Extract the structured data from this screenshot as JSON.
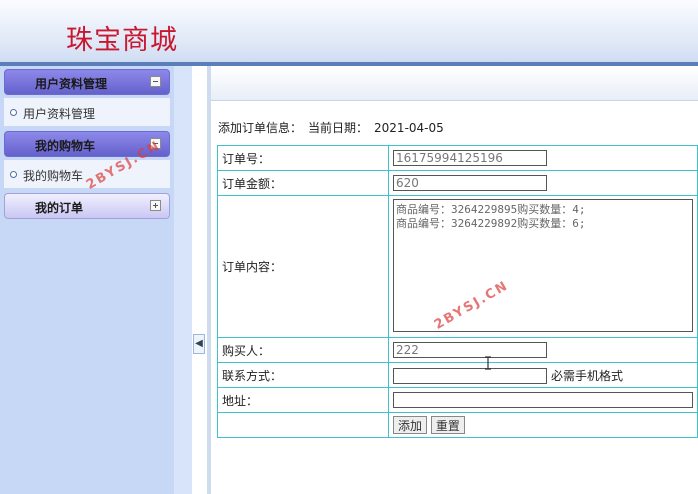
{
  "header": {
    "brand": "珠宝商城"
  },
  "sidebar": {
    "groups": [
      {
        "title": "用户资料管理",
        "items": [
          "用户资料管理"
        ],
        "expanded": true
      },
      {
        "title": "我的购物车",
        "items": [
          "我的购物车"
        ],
        "expanded": true
      },
      {
        "title": "我的订单",
        "items": [],
        "expanded": false
      }
    ]
  },
  "main": {
    "info_label": "添加订单信息：",
    "date_label": "当前日期：",
    "date_value": "2021-04-05",
    "fields": {
      "order_no_label": "订单号：",
      "order_no_value": "16175994125196",
      "amount_label": "订单金额：",
      "amount_value": "620",
      "content_label": "订单内容：",
      "content_value": "商品编号：3264229895购买数量：4;\n商品编号：3264229892购买数量：6;",
      "buyer_label": "购买人：",
      "buyer_value": "222",
      "contact_label": "联系方式：",
      "contact_value": "",
      "contact_hint": "必需手机格式",
      "address_label": "地址：",
      "address_value": ""
    },
    "buttons": {
      "add": "添加",
      "reset": "重置"
    }
  },
  "watermarks": [
    "2BYSJ.CN",
    "2BYSJ.CN",
    "2BYSJ.CN"
  ],
  "colors": {
    "brand": "#c8182f",
    "table_border": "#3fc2d0",
    "sidebar_bg": "#c6d8f6",
    "active_menu": "#6561cc"
  }
}
